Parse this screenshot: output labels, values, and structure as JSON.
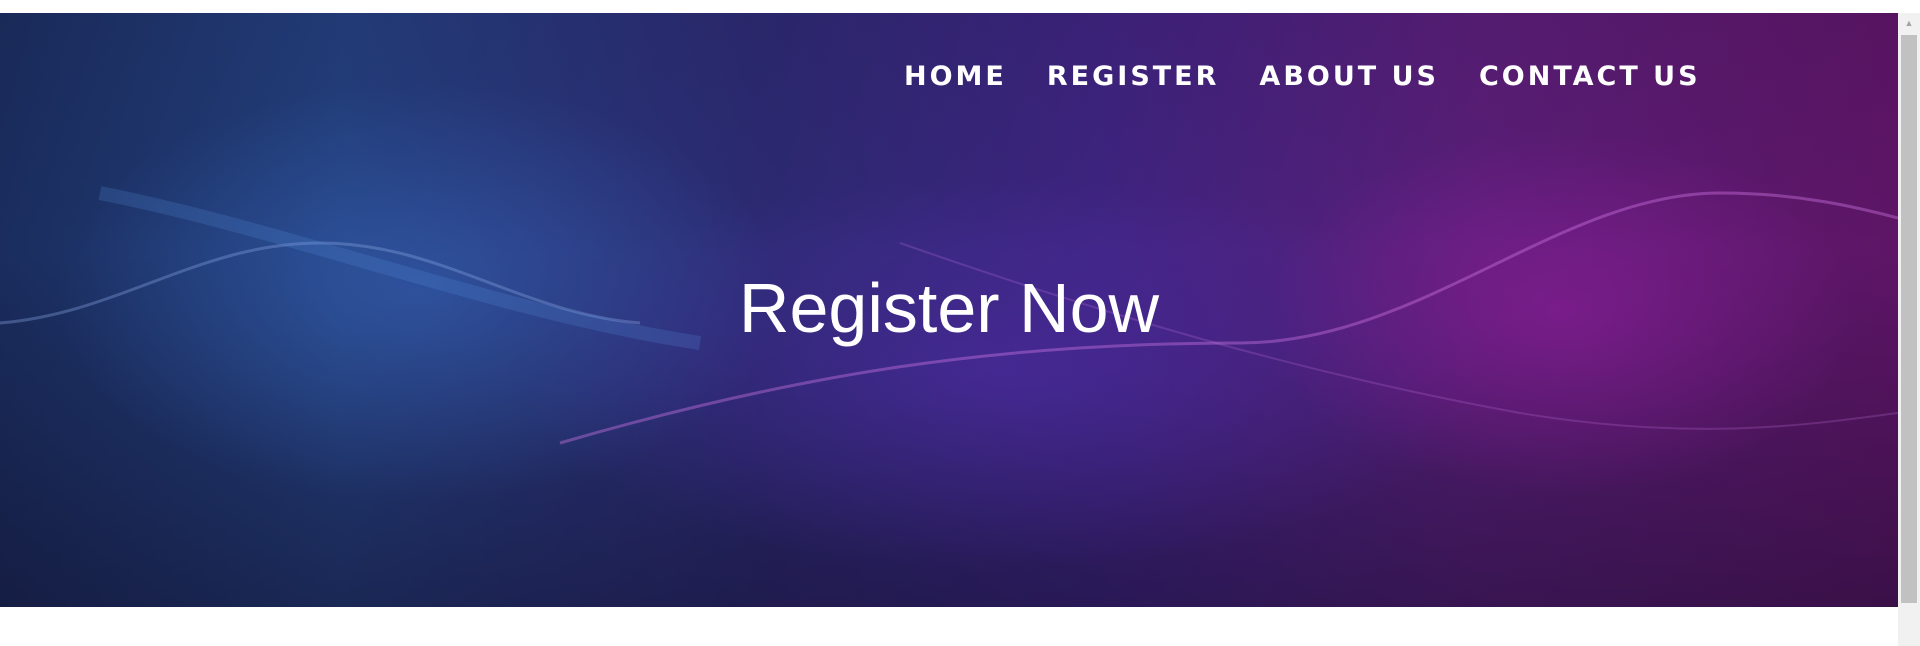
{
  "nav": {
    "items": [
      {
        "label": "HOME"
      },
      {
        "label": "REGISTER"
      },
      {
        "label": "ABOUT US"
      },
      {
        "label": "CONTACT US"
      }
    ]
  },
  "hero": {
    "title": "Register Now"
  },
  "colors": {
    "hero_left": "#1a2d5e",
    "hero_mid": "#2c2a72",
    "hero_right": "#5e1566",
    "text": "#ffffff",
    "scrollbar_track": "#f1f1f1",
    "scrollbar_thumb": "#c1c1c1"
  },
  "icons": {
    "scroll_up": "triangle-up-icon"
  }
}
